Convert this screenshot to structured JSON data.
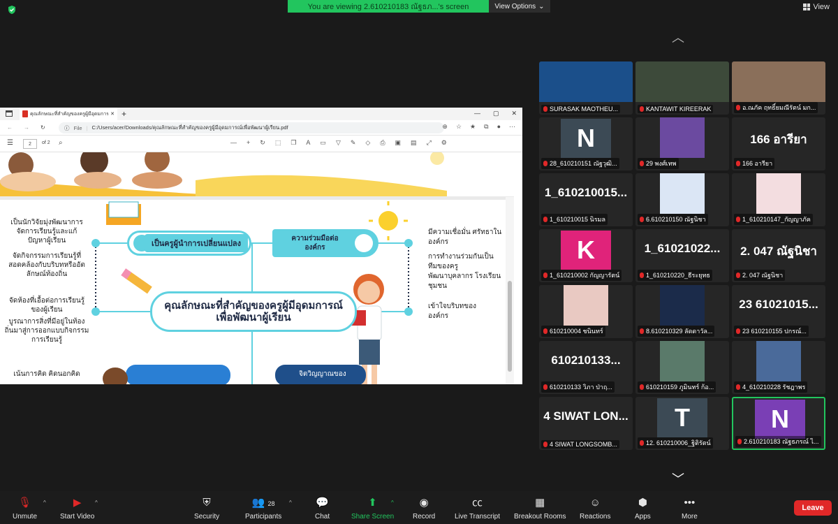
{
  "banner": {
    "viewing_text": "You are viewing 2.610210183 ณัฐธภ...'s screen",
    "view_options": "View Options",
    "view_label": "View"
  },
  "browser": {
    "tab_title": "คุณลักษณะที่สำคัญของครูผู้มีอุดมการณ์...",
    "tab_close": "✕",
    "new_tab": "+",
    "url_prefix": "File",
    "url": "C:/Users/acer/Downloads/คุณลักษณะที่สำคัญของครูผู้มีอุดมการณ์เพื่อพัฒนาผู้เรียน.pdf",
    "page_current": "2",
    "page_total": "of 2"
  },
  "slide": {
    "left_items": [
      "เป็นนักวิจัยมุ่งพัฒนาการ\nจัดการเรียนรู้และแก้\nปัญหาผู้เรียน",
      "จัดกิจกรรมการเรียนรู้ที่\nสอดคล้องกับบริบทหรืออัต\nลักษณ์ท้องถิ่น",
      "จัดห้องที่เอื้อต่อการเรียนรู้\nของผู้เรียน",
      "บูรณาการสิ่งที่มีอยู่ในท้อง\nถิ่นมาสู่การออกแบบกิจกรรม\nการเรียนรู้",
      "เน้นการคิด คิดนอกคิด"
    ],
    "pill_left": "เป็นครูผู้นำการเปลี่ยนแปลง",
    "pill_right": "ความร่วมมือต่อ\nองค์กร",
    "center_title": "คุณลักษณะที่สำคัญของครูผู้มีอุดมการณ์\nเพื่อพัฒนาผู้เรียน",
    "right_items": [
      "มีความเชื่อมั่น ศรัทธาใน\nองค์กร",
      "การทำงานร่วมกันเป็น\nทีมของครู\nพัฒนาบุคลากร โรงเรียน\nชุมชน",
      "เข้าใจบริบทของ\nองค์กร"
    ],
    "bottom_right_pill": "จิตวิญญาณของ"
  },
  "participants": [
    {
      "name": "SURASAK MAOTHEU...",
      "kind": "video",
      "color": "#1b4f8a"
    },
    {
      "name": "KANTAWIT KIREERAK",
      "kind": "video",
      "color": "#3d4a3a"
    },
    {
      "name": "อ.ณภัค ฤทธิ์ยมณีรัตน์ มก...",
      "kind": "video",
      "color": "#8a6f5a"
    },
    {
      "name": "28_610210151 ณัฐวุฒิ...",
      "kind": "letter",
      "letter": "N",
      "color": "#3c4a55"
    },
    {
      "name": "29 พงศ์เทพ",
      "kind": "video",
      "color": "#6b4aa0"
    },
    {
      "name": "166 อารียา",
      "kind": "text",
      "big": "166 อารียา"
    },
    {
      "name": "1_610210015 นิรมล",
      "kind": "text",
      "big": "1_610210015..."
    },
    {
      "name": "6.610210150 ณัฐนิชา",
      "kind": "video",
      "color": "#dbe6f5"
    },
    {
      "name": "1_610210147_กัญญาภัค",
      "kind": "video",
      "color": "#f3dde0"
    },
    {
      "name": "1_610210002 กัญญารัตน์",
      "kind": "letter",
      "letter": "K",
      "color": "#e0237a"
    },
    {
      "name": "1_610210220_ธีระยุทธ",
      "kind": "text",
      "big": "1_61021022..."
    },
    {
      "name": "2. 047 ณัฐนิชา",
      "kind": "text",
      "big": "2. 047 ณัฐนิชา"
    },
    {
      "name": "610210004 ชนินทร์",
      "kind": "video",
      "color": "#e9c9c2"
    },
    {
      "name": "8.610210329 ลัดดาวัล...",
      "kind": "video",
      "color": "#1b2b4a"
    },
    {
      "name": "23 610210155 ปกรณ์...",
      "kind": "text",
      "big": "23 61021015..."
    },
    {
      "name": "610210133 วิภา ป่าฤ...",
      "kind": "text",
      "big": "610210133..."
    },
    {
      "name": "610210159 ภูมินทร์ ก้อ...",
      "kind": "video",
      "color": "#5a7a6a"
    },
    {
      "name": "4_610210228 รัชฎาพร",
      "kind": "video",
      "color": "#4a6a9a"
    },
    {
      "name": "4 SIWAT LONGSOMB...",
      "kind": "text",
      "big": "4 SIWAT LON..."
    },
    {
      "name": "12. 610210006_ฐิติรัตน์",
      "kind": "letter",
      "letter": "T",
      "color": "#3c4a55"
    },
    {
      "name": "2.610210183 ณัฐธภรณ์ ไ...",
      "kind": "letter",
      "letter": "N",
      "color": "#7a3fb5",
      "active": true
    }
  ],
  "toolbar": {
    "unmute": "Unmute",
    "start_video": "Start Video",
    "security": "Security",
    "participants": "Participants",
    "participants_count": "28",
    "chat": "Chat",
    "share_screen": "Share Screen",
    "record": "Record",
    "live_transcript": "Live Transcript",
    "breakout_rooms": "Breakout Rooms",
    "reactions": "Reactions",
    "apps": "Apps",
    "more": "More",
    "leave": "Leave"
  }
}
